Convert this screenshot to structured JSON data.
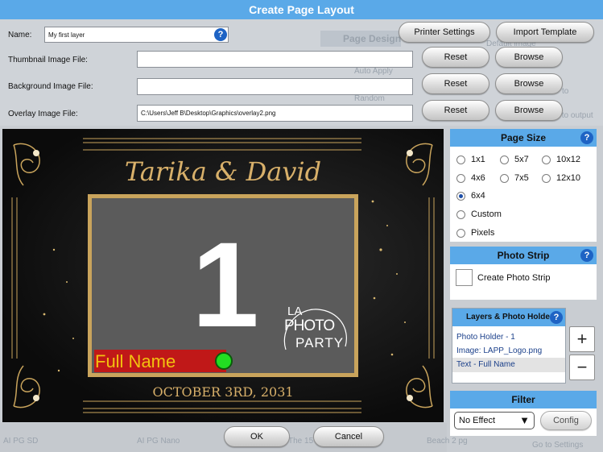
{
  "window": {
    "title": "Create Page Layout"
  },
  "form": {
    "name_label": "Name:",
    "name_value": "My first layer",
    "thumbnail_label": "Thumbnail Image File:",
    "thumbnail_value": "",
    "background_label": "Background Image File:",
    "background_value": "",
    "overlay_label": "Overlay Image File:",
    "overlay_value": "C:\\Users\\Jeff B\\Desktop\\Graphics\\overlay2.png"
  },
  "buttons": {
    "printer_settings": "Printer Settings",
    "import_template": "Import Template",
    "reset": "Reset",
    "browse": "Browse",
    "ok": "OK",
    "cancel": "Cancel",
    "config": "Config",
    "add": "+",
    "remove": "−"
  },
  "behind": {
    "page_design": "Page Design",
    "auto_apply": "Auto Apply",
    "random": "Random",
    "default_image": "Default image",
    "to": "to",
    "to_output": "s to output",
    "thumbs": [
      "AI PG SD",
      "AI PG Nano",
      "The 15",
      "Beach 2 pg"
    ],
    "activate": "Go to Settings"
  },
  "canvas": {
    "names": "Tarika & David",
    "number": "1",
    "logo": {
      "line1": "LA",
      "line2": "PHOTO",
      "line3": "PARTY"
    },
    "field_label": "Full Name",
    "date": "OCTOBER 3RD, 2031"
  },
  "page_size": {
    "title": "Page Size",
    "options": [
      "1x1",
      "5x7",
      "10x12",
      "4x6",
      "7x5",
      "12x10",
      "6x4",
      "Custom",
      "Pixels"
    ],
    "selected": "6x4"
  },
  "photo_strip": {
    "title": "Photo Strip",
    "checkbox_label": "Create Photo Strip",
    "checked": false
  },
  "layers": {
    "title": "Layers & Photo Holders",
    "items": [
      "Photo Holder - 1",
      "Image: LAPP_Logo.png",
      "Text - Full Name"
    ],
    "selected_index": 2
  },
  "filter": {
    "title": "Filter",
    "selected": "No Effect"
  },
  "colors": {
    "accent": "#5aa9e8",
    "gold": "#c9a45c",
    "field_red": "#c01818",
    "handle_green": "#22dd22"
  }
}
